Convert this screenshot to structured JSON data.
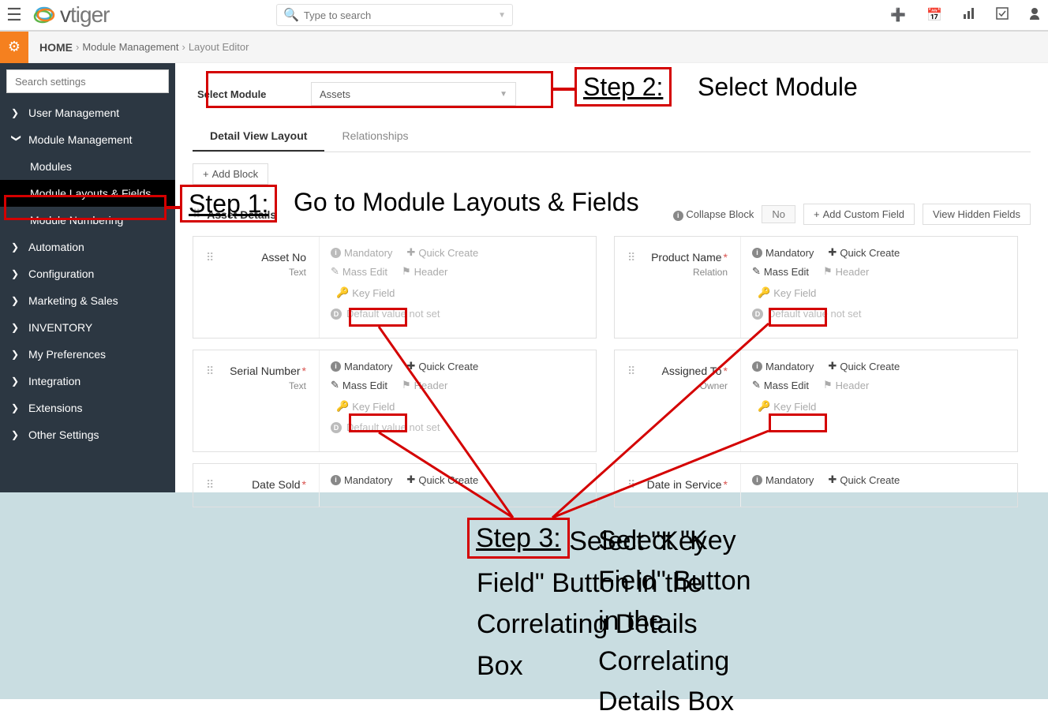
{
  "topbar": {
    "search_placeholder": "Type to search",
    "logo_text_1": "v",
    "logo_text_2": "tiger"
  },
  "breadcrumb": {
    "home": "HOME",
    "module_management": "Module Management",
    "layout_editor": "Layout Editor"
  },
  "sidebar": {
    "search_placeholder": "Search settings",
    "items": {
      "user_management": "User Management",
      "module_management": "Module Management",
      "modules": "Modules",
      "module_layouts_fields": "Module Layouts & Fields",
      "module_numbering": "Module Numbering",
      "automation": "Automation",
      "configuration": "Configuration",
      "marketing_sales": "Marketing & Sales",
      "inventory": "INVENTORY",
      "my_preferences": "My Preferences",
      "integration": "Integration",
      "extensions": "Extensions",
      "other_settings": "Other Settings"
    }
  },
  "content": {
    "select_module_label": "Select Module",
    "select_module_value": "Assets",
    "tabs": {
      "detail_view": "Detail View Layout",
      "relationships": "Relationships"
    },
    "add_block": "Add Block",
    "block_title": "Asset Details",
    "collapse_block": "Collapse Block",
    "collapse_value": "No",
    "add_custom_field": "Add Custom Field",
    "view_hidden_fields": "View Hidden Fields"
  },
  "field_labels": {
    "mandatory": "Mandatory",
    "quick_create": "Quick Create",
    "mass_edit": "Mass Edit",
    "header": "Header",
    "key_field": "Key Field",
    "default_not_set": "Default value not set"
  },
  "fields": {
    "asset_no": {
      "name": "Asset No",
      "type": "Text",
      "required": false
    },
    "product_name": {
      "name": "Product Name",
      "type": "Relation",
      "required": true
    },
    "serial_number": {
      "name": "Serial Number",
      "type": "Text",
      "required": true
    },
    "assigned_to": {
      "name": "Assigned To",
      "type": "Owner",
      "required": true
    },
    "date_sold": {
      "name": "Date Sold",
      "type": "",
      "required": true
    },
    "date_in_service": {
      "name": "Date in Service",
      "type": "",
      "required": true
    }
  },
  "annotations": {
    "step1_label": "Step 1:",
    "step1_text": "Go to Module Layouts & Fields",
    "step2_label": "Step 2:",
    "step2_text": "Select Module",
    "step3_label": "Step 3:",
    "step3_text": "Select \"Key Field\" Button in the Correlating Details Box"
  }
}
